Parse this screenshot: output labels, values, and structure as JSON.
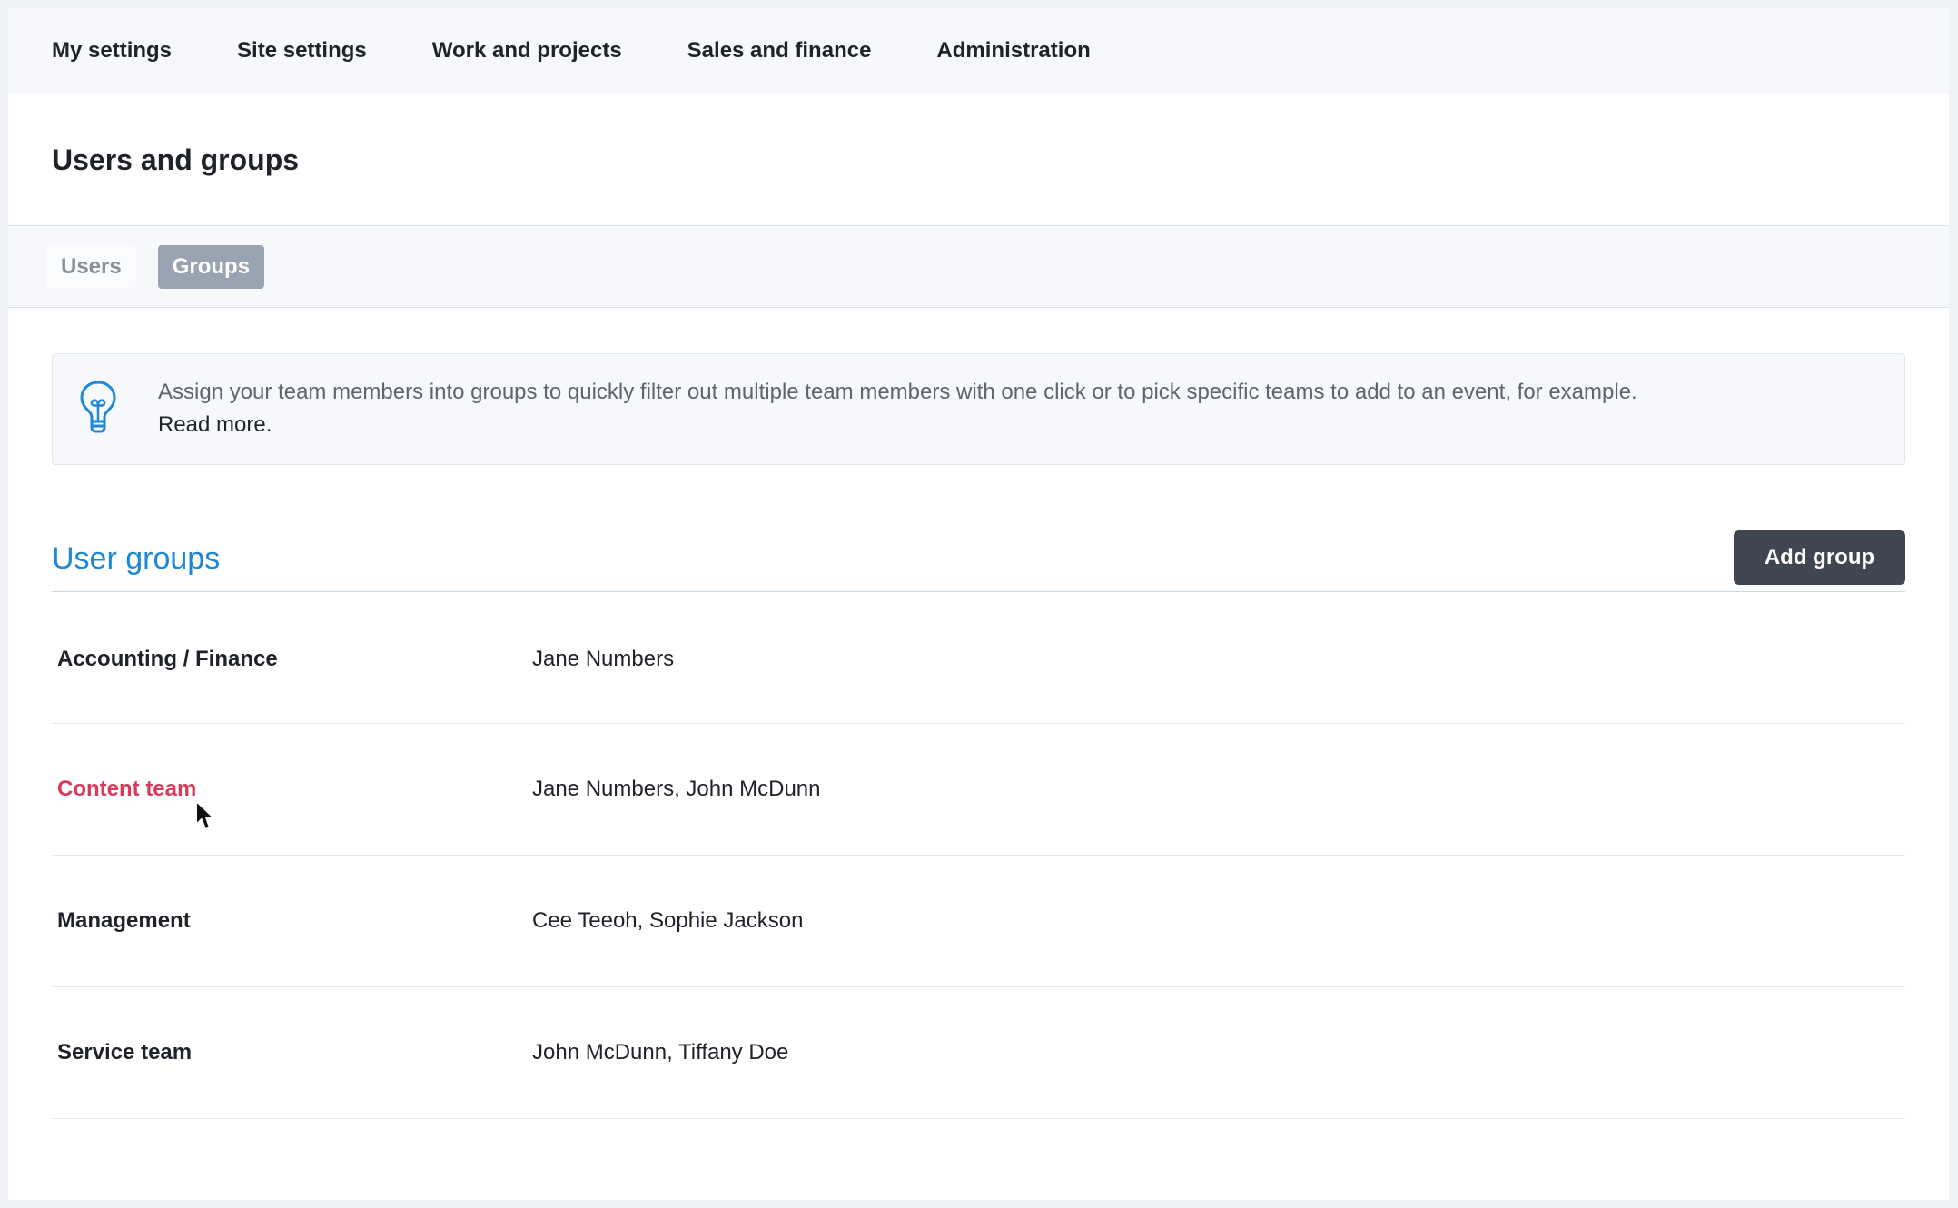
{
  "topnav": {
    "items": [
      {
        "label": "My settings"
      },
      {
        "label": "Site settings"
      },
      {
        "label": "Work and projects"
      },
      {
        "label": "Sales and finance"
      },
      {
        "label": "Administration"
      }
    ]
  },
  "page": {
    "title": "Users and groups"
  },
  "tabs": {
    "users": "Users",
    "groups": "Groups",
    "active": "Groups"
  },
  "info": {
    "icon": "lightbulb-icon",
    "text": "Assign your team members into groups to quickly filter out multiple team members with one click or to pick specific teams to add to an event, for example.",
    "link": "Read more."
  },
  "section": {
    "title": "User groups",
    "add_button": "Add group"
  },
  "groups": [
    {
      "name": "Accounting / Finance",
      "members": "Jane Numbers"
    },
    {
      "name": "Content team",
      "members": "Jane Numbers, John McDunn"
    },
    {
      "name": "Management",
      "members": "Cee Teeoh, Sophie Jackson"
    },
    {
      "name": "Service team",
      "members": "John McDunn, Tiffany Doe"
    }
  ],
  "colors": {
    "accent": "#1f88d6",
    "hover_link": "#d93a5a",
    "button_dark": "#3f4650",
    "active_tab": "#9aa3b1"
  }
}
